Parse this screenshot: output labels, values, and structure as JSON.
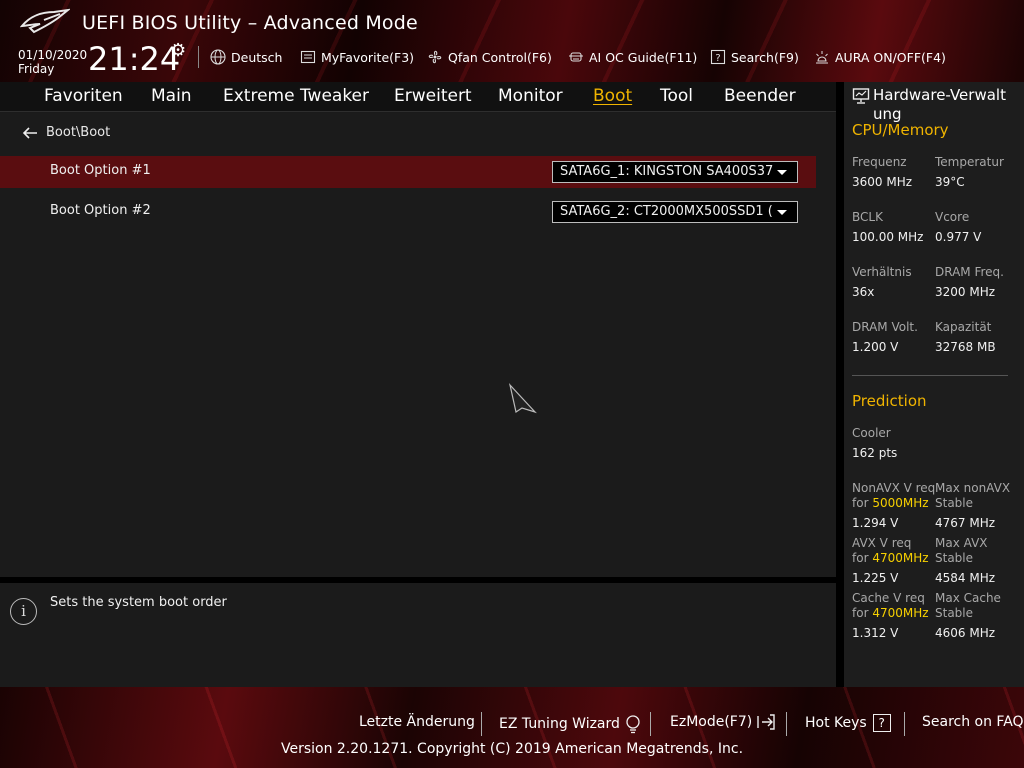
{
  "header": {
    "title": "UEFI BIOS Utility – Advanced Mode",
    "date": "01/10/2020",
    "day": "Friday",
    "time": "21:24",
    "menu": {
      "language": "Deutsch",
      "myfavorite": "MyFavorite(F3)",
      "qfan": "Qfan Control(F6)",
      "aioc": "AI OC Guide(F11)",
      "search": "Search(F9)",
      "aura": "AURA ON/OFF(F4)"
    }
  },
  "tabs": [
    "Favoriten",
    "Main",
    "Extreme Tweaker",
    "Erweitert",
    "Monitor",
    "Boot",
    "Tool",
    "Beender"
  ],
  "active_tab": "Boot",
  "breadcrumb": "Boot\\Boot",
  "options": [
    {
      "label": "Boot Option #1",
      "value": "SATA6G_1: KINGSTON SA400S37"
    },
    {
      "label": "Boot Option #2",
      "value": "SATA6G_2: CT2000MX500SSD1 ("
    }
  ],
  "help_text": "Sets the system boot order",
  "sidebar": {
    "title": "Hardware-Verwaltung",
    "cpu_section": "CPU/Memory",
    "cpu": [
      {
        "label": "Frequenz",
        "value": "3600 MHz"
      },
      {
        "label": "Temperatur",
        "value": "39°C"
      },
      {
        "label": "BCLK",
        "value": "100.00 MHz"
      },
      {
        "label": "Vcore",
        "value": "0.977 V"
      },
      {
        "label": "Verhältnis",
        "value": "36x"
      },
      {
        "label": "DRAM Freq.",
        "value": "3200 MHz"
      },
      {
        "label": "DRAM Volt.",
        "value": "1.200 V"
      },
      {
        "label": "Kapazität",
        "value": "32768 MB"
      }
    ],
    "prediction_section": "Prediction",
    "cooler_label": "Cooler",
    "cooler_value": "162 pts",
    "pred": {
      "nonavx_label": "NonAVX V req",
      "nonavx_for": "for",
      "nonavx_freq": "5000MHz",
      "nonavx_value": "1.294 V",
      "max_nonavx_label": "Max nonAVX",
      "max_nonavx_stable": "Stable",
      "max_nonavx_value": "4767 MHz",
      "avx_label": "AVX V req",
      "avx_for": "for",
      "avx_freq": "4700MHz",
      "avx_value": "1.225 V",
      "max_avx_label": "Max AVX",
      "max_avx_stable": "Stable",
      "max_avx_value": "4584 MHz",
      "cache_label": "Cache V req",
      "cache_for": "for",
      "cache_freq": "4700MHz",
      "cache_value": "1.312 V",
      "max_cache_label": "Max Cache",
      "max_cache_stable": "Stable",
      "max_cache_value": "4606 MHz"
    }
  },
  "footer": {
    "last_change": "Letzte Änderung",
    "ez_tuning": "EZ Tuning Wizard",
    "ezmode": "EzMode(F7)",
    "hotkeys": "Hot Keys",
    "faq": "Search on FAQ",
    "hotkeys_glyph": "?",
    "copyright": "Version 2.20.1271. Copyright (C) 2019 American Megatrends, Inc."
  },
  "colors": {
    "accent": "#f0b400",
    "selected_row": "#5a0d10",
    "highlight": "#f7d000"
  }
}
